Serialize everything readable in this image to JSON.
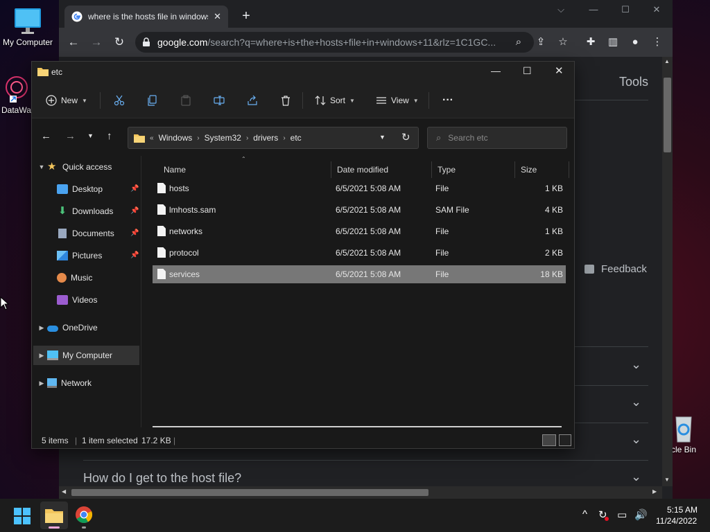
{
  "desktop": {
    "icons": [
      {
        "label": "My Computer"
      },
      {
        "label": "DataWa"
      },
      {
        "label": "cle Bin"
      }
    ]
  },
  "browser": {
    "tab_title": "where is the hosts file in windows",
    "new_tab": "+",
    "url_host": "google.com",
    "url_rest": "/search?q=where+is+the+hosts+file+in+windows+11&rlz=1C1GC...",
    "page": {
      "tools_label": "Tools",
      "feedback_label": "Feedback",
      "faq_question": "How do I get to the host file?"
    }
  },
  "explorer": {
    "title": "etc",
    "commands": {
      "new": "New",
      "sort": "Sort",
      "view": "View",
      "more": "···"
    },
    "breadcrumb": {
      "overflow": "«",
      "parts": [
        "Windows",
        "System32",
        "drivers",
        "etc"
      ]
    },
    "search_placeholder": "Search etc",
    "nav": {
      "quick_access": "Quick access",
      "desktop": "Desktop",
      "downloads": "Downloads",
      "documents": "Documents",
      "pictures": "Pictures",
      "music": "Music",
      "videos": "Videos",
      "onedrive": "OneDrive",
      "my_computer": "My Computer",
      "network": "Network"
    },
    "columns": {
      "name": "Name",
      "date": "Date modified",
      "type": "Type",
      "size": "Size"
    },
    "files": [
      {
        "name": "hosts",
        "date": "6/5/2021 5:08 AM",
        "type": "File",
        "size": "1 KB"
      },
      {
        "name": "lmhosts.sam",
        "date": "6/5/2021 5:08 AM",
        "type": "SAM File",
        "size": "4 KB"
      },
      {
        "name": "networks",
        "date": "6/5/2021 5:08 AM",
        "type": "File",
        "size": "1 KB"
      },
      {
        "name": "protocol",
        "date": "6/5/2021 5:08 AM",
        "type": "File",
        "size": "2 KB"
      },
      {
        "name": "services",
        "date": "6/5/2021 5:08 AM",
        "type": "File",
        "size": "18 KB"
      }
    ],
    "status": {
      "count": "5 items",
      "selected": "1 item selected",
      "size": "17.2 KB"
    }
  },
  "taskbar": {
    "time": "5:15 AM",
    "date": "11/24/2022"
  },
  "colors": {
    "selected_row": "#777777",
    "folder": "#f2c55c",
    "accent_blue": "#4aa3f0"
  }
}
